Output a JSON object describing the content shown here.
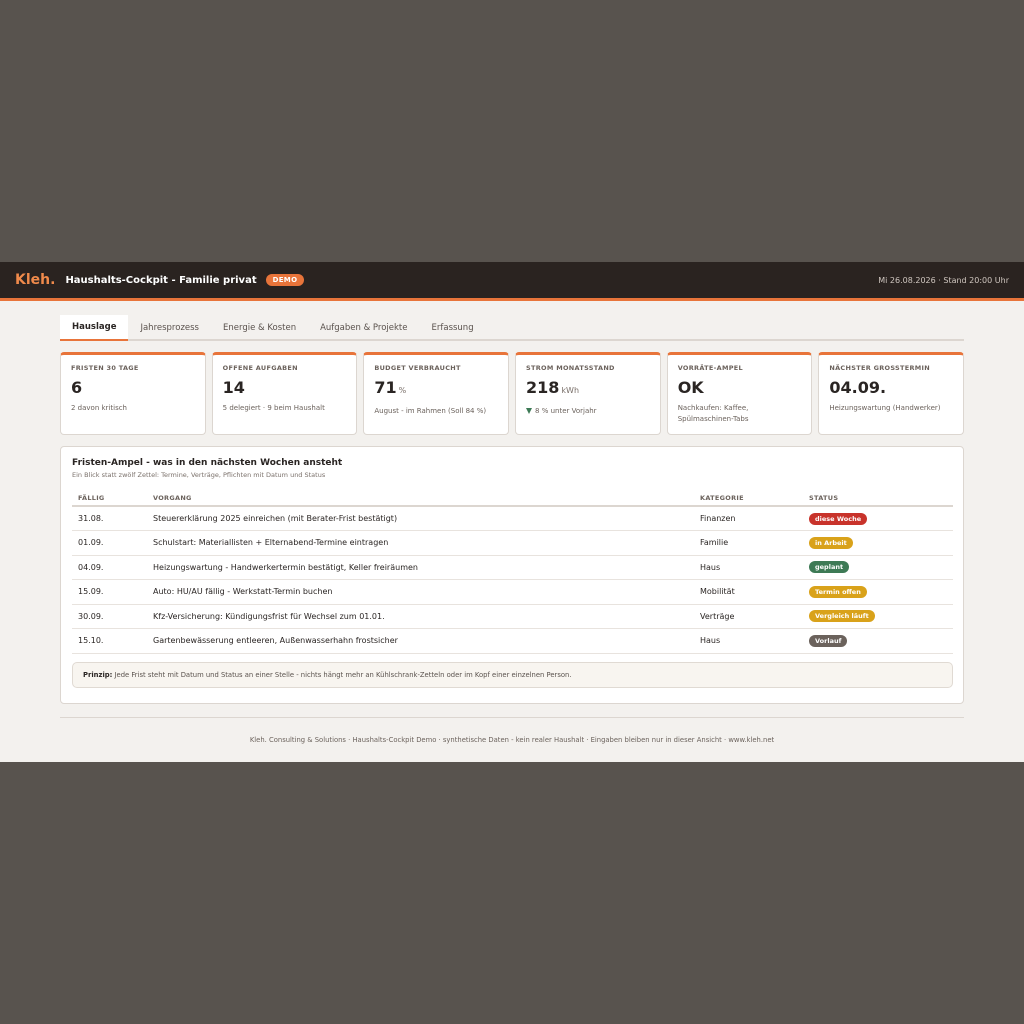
{
  "header": {
    "brand": "Kleh.",
    "title": "Haushalts-Cockpit - Familie privat",
    "badge": "DEMO",
    "stamp": "Mi 26.08.2026 · Stand 20:00 Uhr"
  },
  "tabs": [
    {
      "label": "Hauslage",
      "active": true
    },
    {
      "label": "Jahresprozess"
    },
    {
      "label": "Energie & Kosten"
    },
    {
      "label": "Aufgaben & Projekte"
    },
    {
      "label": "Erfassung"
    }
  ],
  "kpis": [
    {
      "label": "FRISTEN 30 TAGE",
      "value": "6",
      "sub": "2 davon kritisch"
    },
    {
      "label": "OFFENE AUFGABEN",
      "value": "14",
      "sub": "5 delegiert · 9 beim Haushalt"
    },
    {
      "label": "BUDGET VERBRAUCHT",
      "value": "71",
      "unit": "%",
      "sub": "August - im Rahmen (Soll 84 %)"
    },
    {
      "label": "STROM MONATSSTAND",
      "value": "218",
      "unit": "kWh",
      "sub": "8 % unter Vorjahr"
    },
    {
      "label": "VORRÄTE-AMPEL",
      "value": "OK",
      "sub": "Nachkaufen: Kaffee, Spülmaschinen-Tabs"
    },
    {
      "label": "NÄCHSTER GROSSTERMIN",
      "value": "04.09.",
      "sub": "Heizungswartung (Handwerker)"
    }
  ],
  "panel": {
    "title": "Fristen-Ampel - was in den nächsten Wochen ansteht",
    "subtitle": "Ein Blick statt zwölf Zettel: Termine, Verträge, Pflichten mit Datum und Status",
    "columns": [
      "FÄLLIG",
      "VORGANG",
      "KATEGORIE",
      "STATUS"
    ],
    "rows": [
      {
        "due": "31.08.",
        "task": "Steuererklärung 2025 einreichen (mit Berater-Frist bestätigt)",
        "category": "Finanzen",
        "status": "diese Woche",
        "color": "#c8332b"
      },
      {
        "due": "01.09.",
        "task": "Schulstart: Materiallisten + Elternabend-Termine eintragen",
        "category": "Familie",
        "status": "in Arbeit",
        "color": "#d9a21a"
      },
      {
        "due": "04.09.",
        "task": "Heizungswartung - Handwerkertermin bestätigt, Keller freiräumen",
        "category": "Haus",
        "status": "geplant",
        "color": "#3d7a55"
      },
      {
        "due": "15.09.",
        "task": "Auto: HU/AU fällig - Werkstatt-Termin buchen",
        "category": "Mobilität",
        "status": "Termin offen",
        "color": "#d9a21a"
      },
      {
        "due": "30.09.",
        "task": "Kfz-Versicherung: Kündigungsfrist für Wechsel zum 01.01.",
        "category": "Verträge",
        "status": "Vergleich läuft",
        "color": "#d9a21a"
      },
      {
        "due": "15.10.",
        "task": "Gartenbewässerung entleeren, Außenwasserhahn frostsicher",
        "category": "Haus",
        "status": "Vorlauf",
        "color": "#6b625c"
      }
    ],
    "note_label": "Prinzip:",
    "note_text": " Jede Frist steht mit Datum und Status an einer Stelle - nichts hängt mehr an Kühlschrank-Zetteln oder im Kopf einer einzelnen Person."
  },
  "footer": "Kleh. Consulting & Solutions · Haushalts-Cockpit Demo · synthetische Daten - kein realer Haushalt · Eingaben bleiben nur in dieser Ansicht · www.kleh.net"
}
